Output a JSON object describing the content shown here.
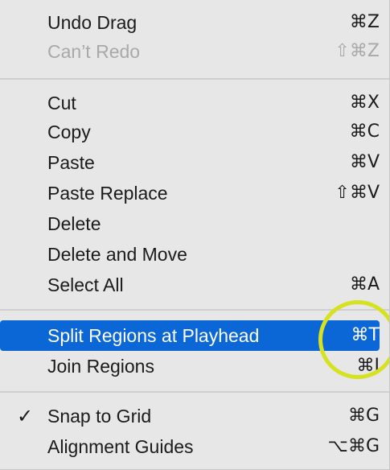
{
  "menu": {
    "undo_drag": {
      "label": "Undo Drag",
      "shortcut": "⌘Z"
    },
    "cant_redo": {
      "label": "Can’t Redo",
      "shortcut": "⇧⌘Z"
    },
    "cut": {
      "label": "Cut",
      "shortcut": "⌘X"
    },
    "copy": {
      "label": "Copy",
      "shortcut": "⌘C"
    },
    "paste": {
      "label": "Paste",
      "shortcut": "⌘V"
    },
    "paste_replace": {
      "label": "Paste Replace",
      "shortcut": "⇧⌘V"
    },
    "delete": {
      "label": "Delete"
    },
    "delete_and_move": {
      "label": "Delete and Move"
    },
    "select_all": {
      "label": "Select All",
      "shortcut": "⌘A"
    },
    "split_regions": {
      "label": "Split Regions at Playhead",
      "shortcut": "⌘T"
    },
    "join_regions": {
      "label": "Join Regions",
      "shortcut": "⌘J"
    },
    "snap_to_grid": {
      "label": "Snap to Grid",
      "shortcut": "⌘G",
      "checkmark": "✓",
      "checked": true
    },
    "alignment_guides": {
      "label": "Alignment Guides",
      "shortcut": "⌥⌘G"
    }
  },
  "colors": {
    "menu_background": "#e7e7e7",
    "selection": "#0b67d6",
    "disabled_text": "#a9a9a9",
    "annotation_ring": "#d6e21f"
  }
}
